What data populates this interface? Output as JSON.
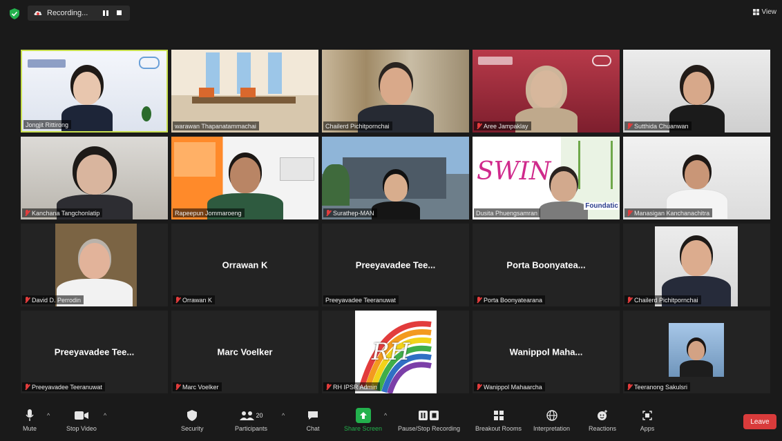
{
  "topbar": {
    "recording_label": "Recording...",
    "view_label": "View"
  },
  "tiles": [
    {
      "name": "Jongjit Rittirong",
      "display": ""
    },
    {
      "name": "warawan Thapanatammachai",
      "display": ""
    },
    {
      "name": "Chailerd Pichitpornchai",
      "display": ""
    },
    {
      "name": "Aree Jampaklay",
      "display": ""
    },
    {
      "name": "Sutthida Chuanwan",
      "display": ""
    },
    {
      "name": "Kanchana Tangchonlatip",
      "display": ""
    },
    {
      "name": "Rapeepun Jommaroeng",
      "display": ""
    },
    {
      "name": "Surathep-MAN",
      "display": ""
    },
    {
      "name": "Dusita Phuengsamran",
      "display": ""
    },
    {
      "name": "Manasigan Kanchanachitra",
      "display": ""
    },
    {
      "name": "David D. Perrodin",
      "display": ""
    },
    {
      "name": "Orrawan K",
      "display": "Orrawan K"
    },
    {
      "name": "Preeyavadee Teeranuwat",
      "display": "Preeyavadee Tee..."
    },
    {
      "name": "Porta Boonyatearana",
      "display": "Porta Boonyatea..."
    },
    {
      "name": "Chailerd Pichitpornchai",
      "display": ""
    },
    {
      "name": "Preeyavadee Teeranuwat",
      "display": "Preeyavadee Tee..."
    },
    {
      "name": "Marc Voelker",
      "display": "Marc Voelker"
    },
    {
      "name": "RH IPSR Admin",
      "display": ""
    },
    {
      "name": "Wanippol Mahaarcha",
      "display": "Wanippol Maha..."
    },
    {
      "name": "Teeranong Sakulsri",
      "display": ""
    }
  ],
  "tile_text": {
    "swing": "SWIN",
    "foundation": "Foundatic",
    "rh_logo": "RH"
  },
  "toolbar": {
    "mute": "Mute",
    "stop_video": "Stop Video",
    "security": "Security",
    "participants": "Participants",
    "participants_count": "20",
    "chat": "Chat",
    "share_screen": "Share Screen",
    "pause_recording": "Pause/Stop Recording",
    "breakout_rooms": "Breakout Rooms",
    "interpretation": "Interpretation",
    "reactions": "Reactions",
    "apps": "Apps",
    "leave": "Leave"
  },
  "colors": {
    "active_speaker_border": "#c9e04f",
    "share_green": "#23b14d",
    "leave_red": "#d93b3b",
    "muted_red": "#e23c3c"
  }
}
